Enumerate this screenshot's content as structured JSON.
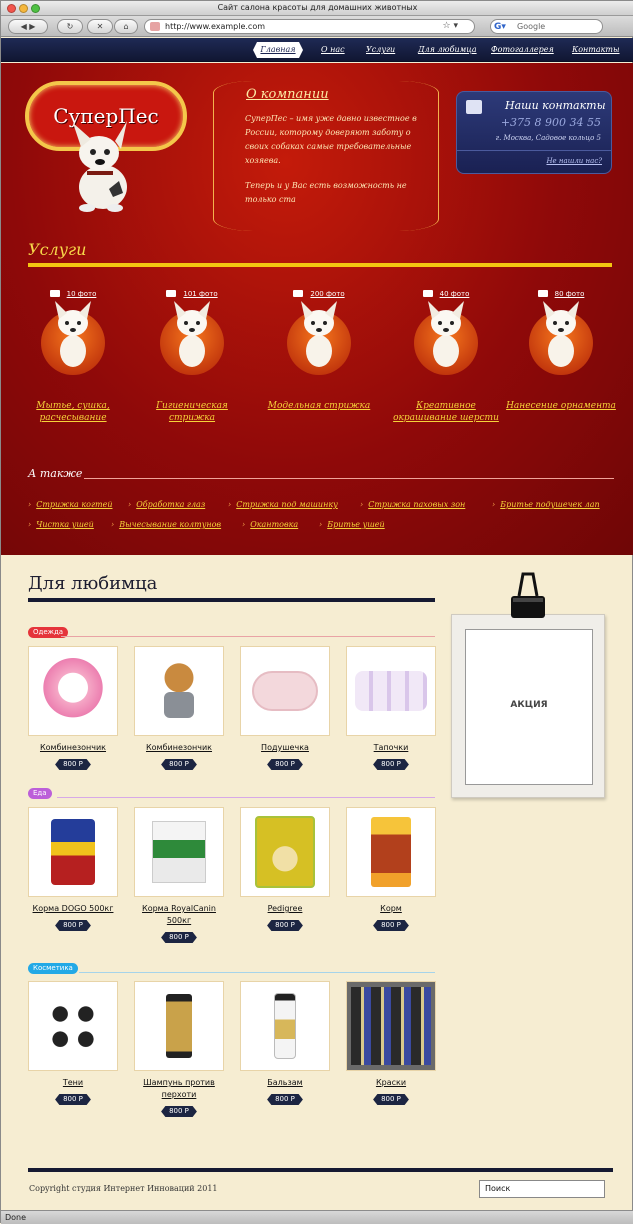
{
  "browser": {
    "title": "Сайт салона красоты для домашних животных",
    "url": "http://www.example.com",
    "search_placeholder": "Google",
    "status": "Done"
  },
  "nav": {
    "items": [
      "Главная",
      "О нас",
      "Услуги",
      "Для любимца",
      "Фотогаллерея",
      "Контакты"
    ]
  },
  "logo": {
    "text": "СуперПес"
  },
  "about": {
    "title": "О компании",
    "text": "СуперПес – имя уже давно известное в России, которому доверяют заботу о своих собаках самые требовательные хозяева.",
    "more": "Теперь и у Вас есть возможность не только ста"
  },
  "contacts": {
    "title": "Наши контакты",
    "phone": "+375 8 900 34 55",
    "address": "г. Москва, Садовое кольцо 5",
    "link": "Не нашли нас?"
  },
  "services": {
    "title": "Услуги",
    "items": [
      {
        "photos": "10 фото",
        "label": "Мытье, сушка, расчесывание"
      },
      {
        "photos": "101 фото",
        "label": "Гигиеническая стрижка"
      },
      {
        "photos": "200 фото",
        "label": "Модельная стрижка"
      },
      {
        "photos": "40 фото",
        "label": "Креативное окрашивание шерсти"
      },
      {
        "photos": "80 фото",
        "label": "Нанесение орнамента"
      }
    ],
    "also_title": "А также",
    "also": [
      "Стрижка когтей",
      "Обработка глаз",
      "Стрижка под машинку",
      "Стрижка паховых зон",
      "Бритье подушечек лап",
      "Чистка ушей",
      "Вычесывание колтунов",
      "Окантовка",
      "Бритье ушей"
    ]
  },
  "shop": {
    "title": "Для любимца",
    "categories": [
      {
        "name": "Одежда",
        "color": "#e5343a",
        "products": [
          {
            "name": "Комбинезончик",
            "price": "800 Р"
          },
          {
            "name": "Комбинезончик",
            "price": "800 Р"
          },
          {
            "name": "Подушечка",
            "price": "800 Р"
          },
          {
            "name": "Тапочки",
            "price": "800 Р"
          }
        ]
      },
      {
        "name": "Еда",
        "color": "#bc5fd9",
        "products": [
          {
            "name": "Корма DOGO 500кг",
            "price": "800 Р"
          },
          {
            "name": "Корма RoyalCanin 500кг",
            "price": "800 Р"
          },
          {
            "name": "Pedigree",
            "price": "800 Р"
          },
          {
            "name": "Корм",
            "price": "800 Р"
          }
        ]
      },
      {
        "name": "Косметика",
        "color": "#23a9e6",
        "products": [
          {
            "name": "Тени",
            "price": "800 Р"
          },
          {
            "name": "Шампунь против перхоти",
            "price": "800 Р"
          },
          {
            "name": "Бальзам",
            "price": "800 Р"
          },
          {
            "name": "Краски",
            "price": "800 Р"
          }
        ]
      }
    ]
  },
  "promo": {
    "label": "АКЦИЯ"
  },
  "footer": {
    "copyright": "Copyright  студия Интернет Инноваций 2011",
    "search_value": "Поиск"
  }
}
